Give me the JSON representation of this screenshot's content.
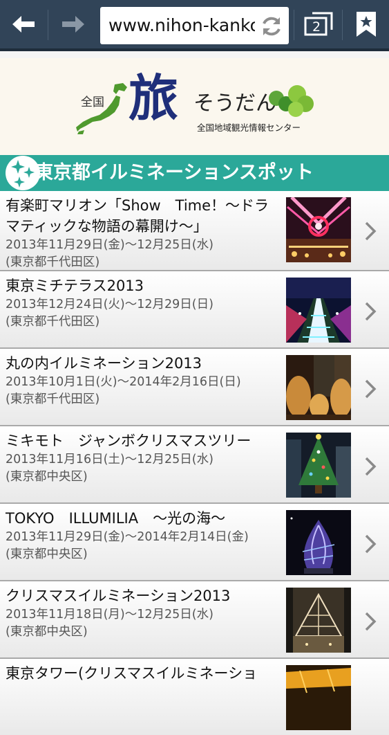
{
  "browser": {
    "url": "www.nihon-kankou.or.jp",
    "tab_count": "2"
  },
  "site": {
    "logo_zenkoku": "全国",
    "logo_tabi": "旅",
    "logo_soudan": "そうだん",
    "subtitle": "全国地域観光情報センター"
  },
  "section": {
    "title": "東京都イルミネーションスポット"
  },
  "items": [
    {
      "title_lines": [
        "有楽町マリオン「Show　Time！～ドラ",
        "マティックな物語の幕開け～」"
      ],
      "date": "2013年11月29日(金)～12月25日(水)",
      "area": "(東京都千代田区)"
    },
    {
      "title_lines": [
        "東京ミチテラス2013"
      ],
      "date": "2013年12月24日(火)～12月29日(日)",
      "area": "(東京都千代田区)"
    },
    {
      "title_lines": [
        "丸の内イルミネーション2013"
      ],
      "date": "2013年10月1日(火)～2014年2月16日(日)",
      "area": "(東京都千代田区)"
    },
    {
      "title_lines": [
        "ミキモト　ジャンボクリスマスツリー"
      ],
      "date": "2013年11月16日(土)～12月25日(水)",
      "area": "(東京都中央区)"
    },
    {
      "title_lines": [
        "TOKYO　ILLUMILIA　～光の海～"
      ],
      "date": "2013年11月29日(金)～2014年2月14日(金)",
      "area": "(東京都中央区)"
    },
    {
      "title_lines": [
        "クリスマスイルミネーション2013"
      ],
      "date": "2013年11月18日(月)～12月25日(水)",
      "area": "(東京都中央区)"
    },
    {
      "title_lines": [
        "東京タワー(クリスマスイルミネーショ"
      ],
      "date": "",
      "area": ""
    }
  ]
}
